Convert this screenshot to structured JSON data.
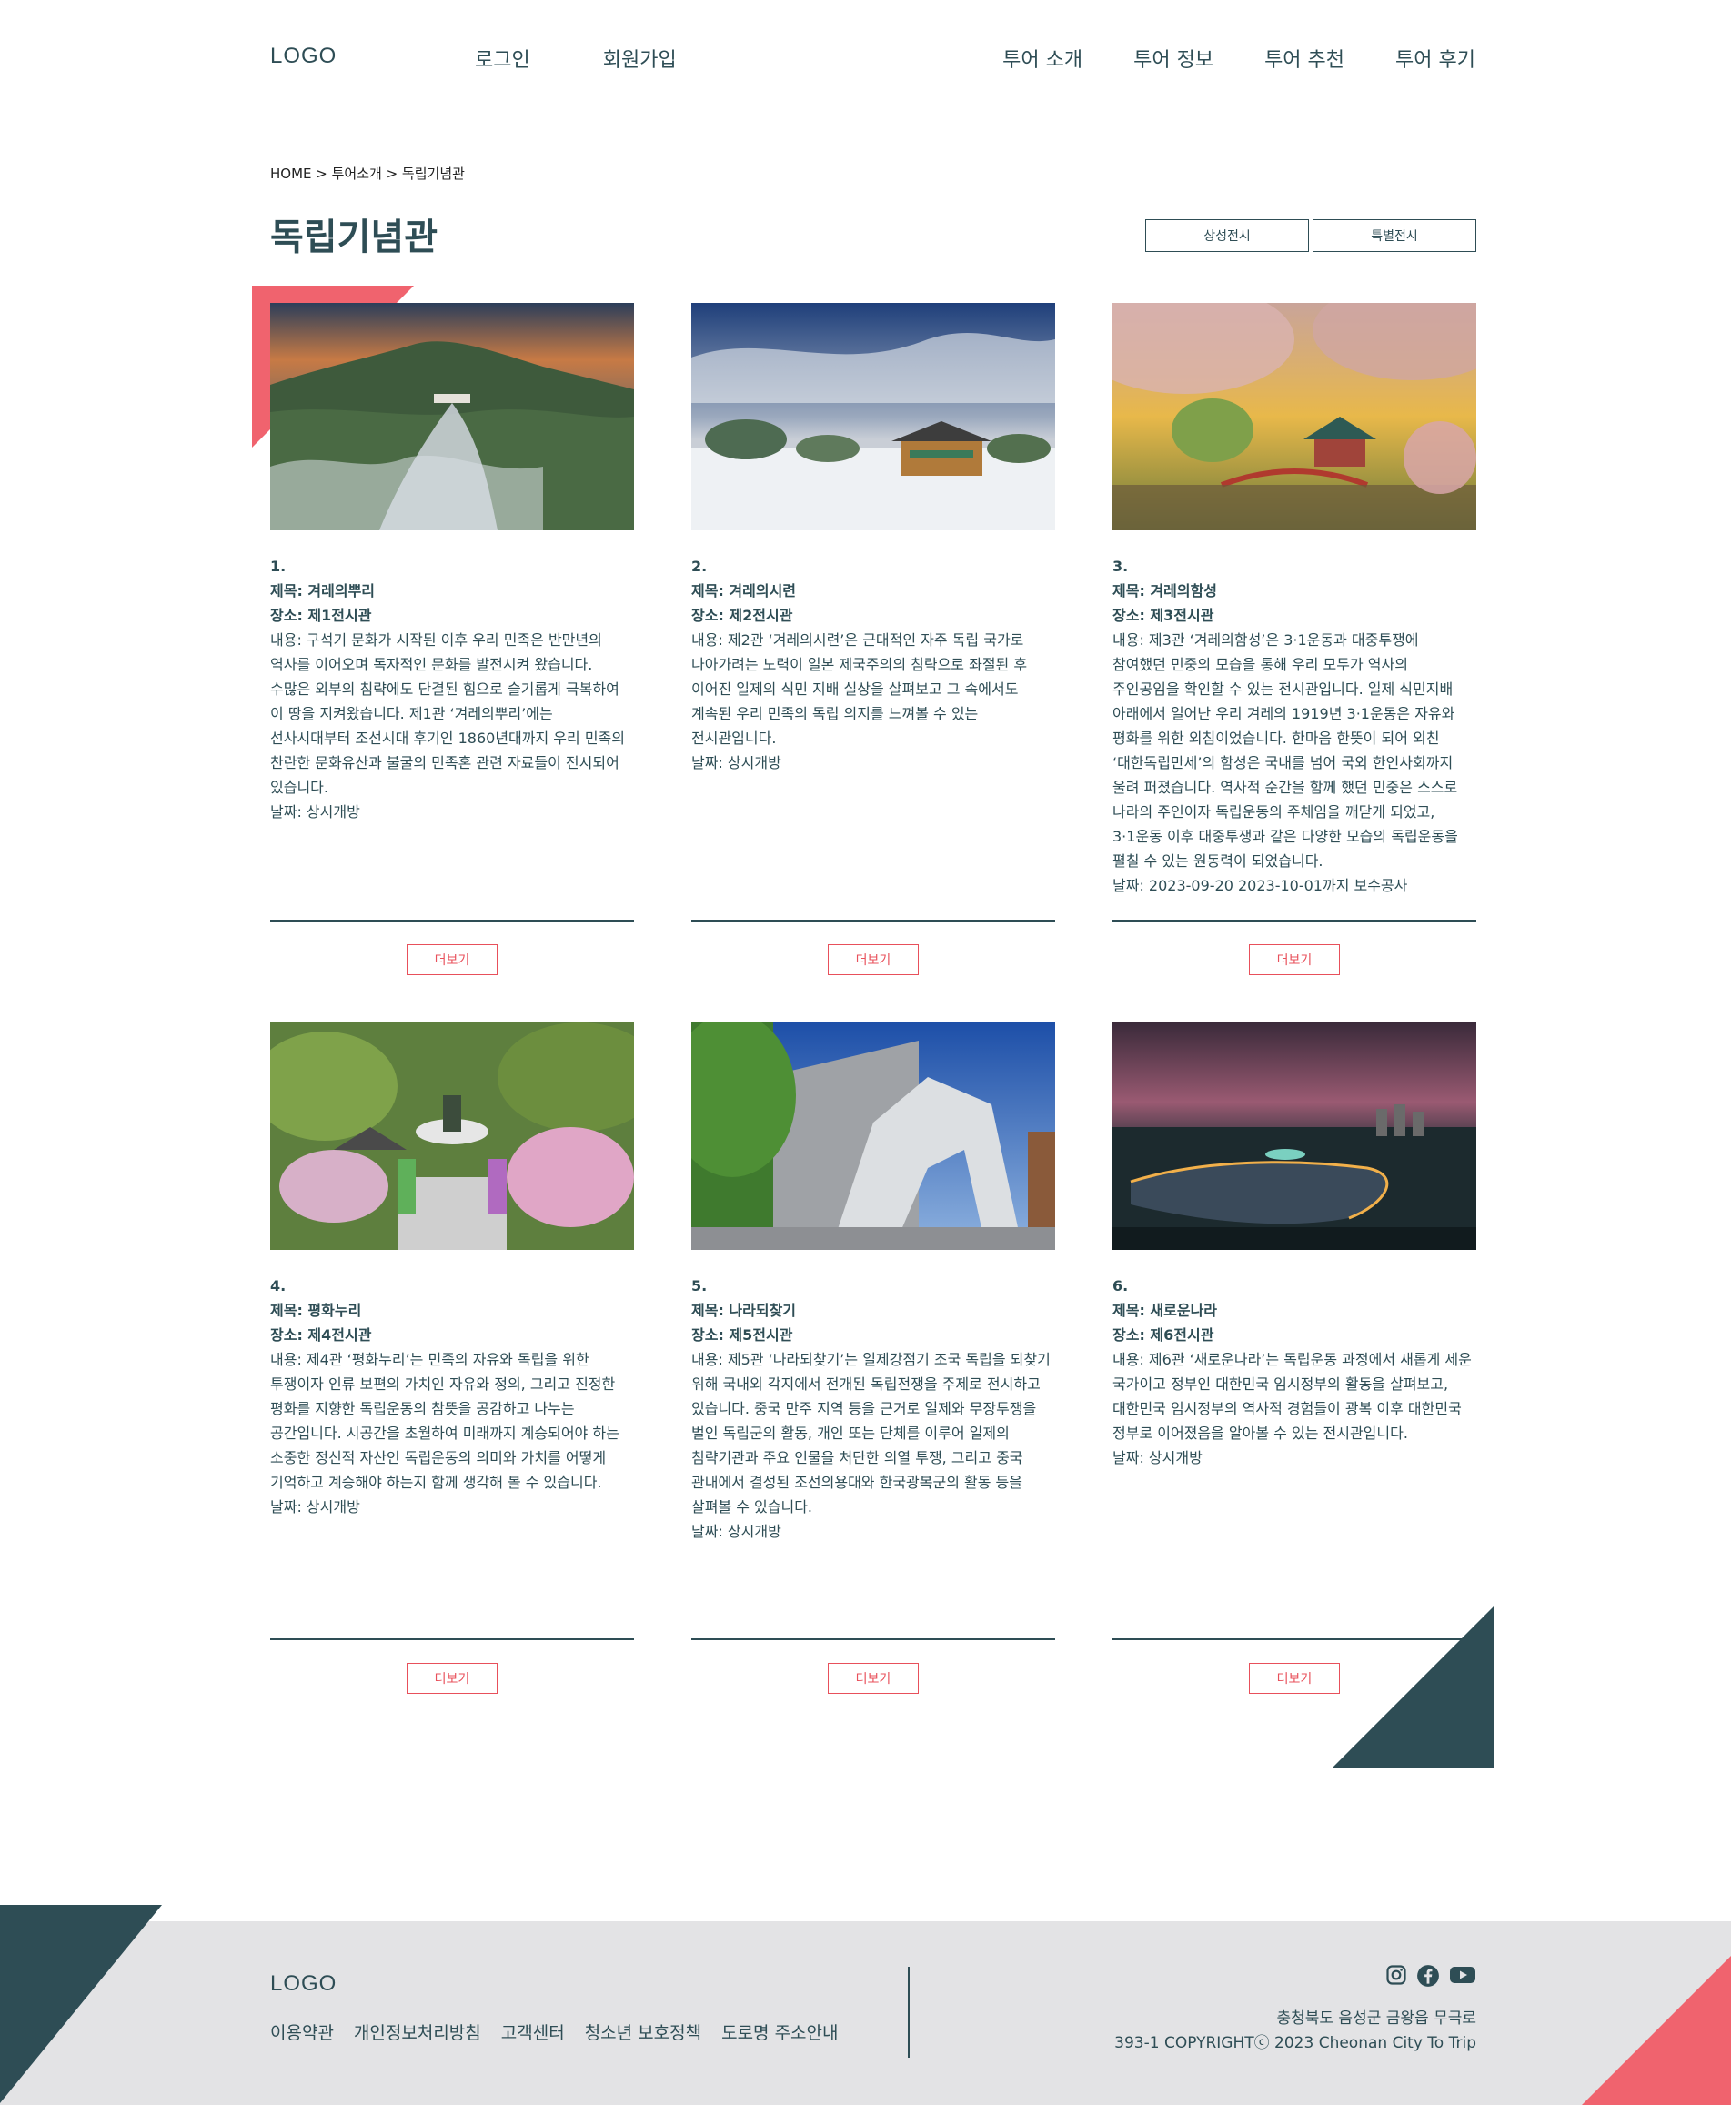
{
  "header": {
    "logo": "LOGO",
    "auth": [
      "로그인",
      "회원가입"
    ],
    "menu": [
      "투어 소개",
      "투어 정보",
      "투어 추천",
      "투어 후기"
    ]
  },
  "breadcrumb": "HOME > 투어소개 > 독립기념관",
  "page_title": "독립기념관",
  "tabs": [
    "상성전시",
    "특별전시"
  ],
  "cards": [
    {
      "number": "1.",
      "title": "제목: 겨레의뿌리",
      "place": "장소: 제1전시관",
      "content": "내용: 구석기 문화가 시작된 이후 우리 민족은 반만년의 역사를 이어오며 독자적인 문화를 발전시켜 왔습니다. 수많은 외부의 침략에도 단결된 힘으로 슬기롭게 극복하여 이 땅을 지켜왔습니다. 제1관 ‘겨레의뿌리’에는 선사시대부터 조선시대 후기인 1860년대까지 우리 민족의 찬란한 문화유산과 불굴의 민족혼 관련 자료들이 전시되어 있습니다.",
      "date": "날짜: 상시개방",
      "more": "더보기"
    },
    {
      "number": "2.",
      "title": "제목: 겨레의시련",
      "place": "장소: 제2전시관",
      "content": "내용: 제2관 ‘겨레의시련’은 근대적인 자주 독립 국가로 나아가려는 노력이 일본 제국주의의 침략으로 좌절된 후 이어진 일제의 식민 지배 실상을 살펴보고 그 속에서도 계속된 우리 민족의 독립 의지를 느껴볼 수 있는 전시관입니다.",
      "date": "날짜: 상시개방",
      "more": "더보기"
    },
    {
      "number": "3.",
      "title": "제목: 겨레의함성",
      "place": "장소: 제3전시관",
      "content": "내용: 제3관 ‘겨레의함성’은 3·1운동과 대중투쟁에 참여했던 민중의 모습을 통해 우리 모두가 역사의 주인공임을 확인할 수 있는 전시관입니다. 일제 식민지배 아래에서 일어난 우리 겨레의 1919년 3·1운동은 자유와 평화를 위한 외침이었습니다. 한마음 한뜻이 되어 외친 ‘대한독립만세’의 함성은 국내를 넘어 국외 한인사회까지 울려 퍼졌습니다. 역사적 순간을 함께 했던 민중은 스스로 나라의 주인이자 독립운동의 주체임을 깨닫게 되었고, 3·1운동 이후 대중투쟁과 같은 다양한 모습의 독립운동을 펼칠 수 있는 원동력이 되었습니다.",
      "date": "날짜: 2023-09-20 2023-10-01까지 보수공사",
      "more": "더보기"
    },
    {
      "number": "4.",
      "title": "제목: 평화누리",
      "place": "장소: 제4전시관",
      "content": "내용: 제4관 ‘평화누리’는 민족의 자유와 독립을 위한 투쟁이자 인류 보편의 가치인 자유와 정의, 그리고 진정한 평화를 지향한 독립운동의 참뜻을 공감하고 나누는 공간입니다. 시공간을 초월하여 미래까지 계승되어야 하는 소중한 정신적 자산인 독립운동의 의미와 가치를 어떻게 기억하고 계승해야 하는지 함께 생각해 볼 수 있습니다.",
      "date": "날짜: 상시개방",
      "more": "더보기"
    },
    {
      "number": "5.",
      "title": "제목: 나라되찾기",
      "place": "장소: 제5전시관",
      "content": "내용: 제5관 ‘나라되찾기’는 일제강점기 조국 독립을 되찾기 위해 국내외 각지에서 전개된 독립전쟁을 주제로 전시하고 있습니다. 중국 만주 지역 등을 근거로 일제와 무장투쟁을 벌인 독립군의 활동, 개인 또는 단체를 이루어 일제의 침략기관과 주요 인물을 처단한 의열 투쟁, 그리고 중국 관내에서 결성된 조선의용대와 한국광복군의 활동 등을 살펴볼 수 있습니다.",
      "date": "날짜: 상시개방",
      "more": "더보기"
    },
    {
      "number": "6.",
      "title": "제목: 새로운나라",
      "place": "장소: 제6전시관",
      "content": "내용: 제6관 ‘새로운나라’는 독립운동 과정에서 새롭게 세운 국가이고 정부인 대한민국 임시정부의 활동을 살펴보고, 대한민국 임시정부의 역사적 경험들이 광복 이후 대한민국 정부로 이어졌음을 알아볼 수 있는 전시관입니다.",
      "date": "날짜: 상시개방",
      "more": "더보기"
    }
  ],
  "footer": {
    "logo": "LOGO",
    "links": [
      "이용약관",
      "개인정보처리방침",
      "고객센터",
      "청소년 보호정책",
      "도로명 주소안내"
    ],
    "address": "충청북도 음성군 금왕읍 무극로",
    "copyright": "393-1 COPYRIGHTⓒ 2023 Cheonan City To Trip",
    "social": [
      "instagram-icon",
      "facebook-icon",
      "youtube-icon"
    ]
  },
  "colors": {
    "primary": "#2e4d55",
    "accent": "#f0636e",
    "footer_bg": "#e3e3e5"
  }
}
